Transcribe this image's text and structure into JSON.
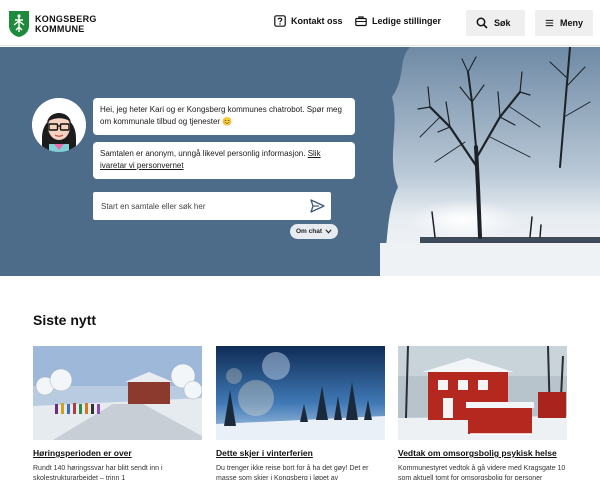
{
  "header": {
    "logo_line1": "KONGSBERG",
    "logo_line2": "KOMMUNE",
    "contact_label": "Kontakt oss",
    "jobs_label": "Ledige stillinger",
    "search_label": "Søk",
    "menu_label": "Meny"
  },
  "hero": {
    "chat_greeting": "Hei, jeg heter Kari og er Kongsberg kommunes chatrobot. Spør meg om kommunale tilbud og tjenester 😊",
    "privacy_text": "Samtalen er anonym, unngå likevel personlig informasjon.",
    "privacy_link": "Slik ivaretar vi personvernet",
    "search_placeholder": "Start en samtale eller søk her",
    "about_chat_label": "Om chat"
  },
  "news": {
    "title": "Siste nytt",
    "cards": [
      {
        "title": "Høringsperioden er over",
        "description": "Rundt 140 høringssvar har blitt sendt inn i skolestrukturarbeidet – trinn 1"
      },
      {
        "title": "Dette skjer i vinterferien",
        "description": "Du trenger ikke reise bort for å ha det gøy! Det er masse som skjer i Kongsberg i løpet av"
      },
      {
        "title": "Vedtak om omsorgsbolig psykisk helse",
        "description": "Kommunestyret vedtok å gå videre med Kragsgate 10 som aktuell tomt for omsorgsbolig for personer"
      }
    ]
  },
  "colors": {
    "hero_background": "#4d6c8a",
    "header_button_bg": "#efefef",
    "logo_green": "#1e8a3c"
  }
}
